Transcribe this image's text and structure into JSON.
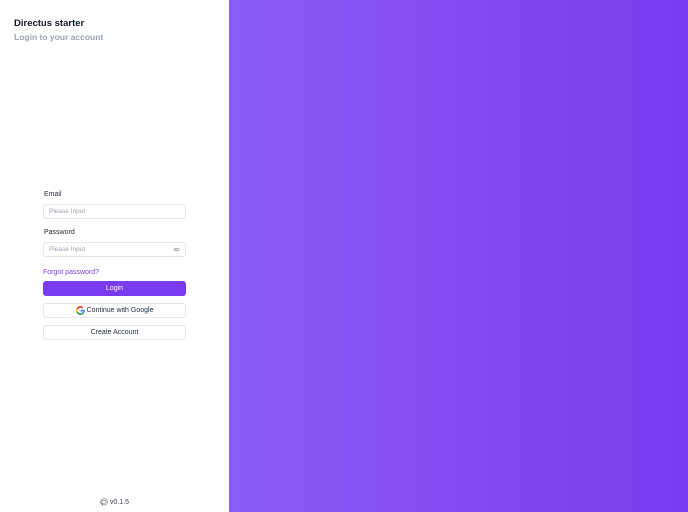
{
  "brand": {
    "title": "Directus starter",
    "subtitle": "Login to your account"
  },
  "form": {
    "email_label": "Email",
    "email_placeholder": "Please Input",
    "password_label": "Password",
    "password_placeholder": "Please Input",
    "forgot_label": "Forgot password?",
    "login_label": "Login",
    "google_label": "Continue with Google",
    "create_label": "Create Account"
  },
  "footer": {
    "version": "v0.1.5",
    "icon": "github-icon"
  },
  "colors": {
    "accent": "#7c3aed",
    "gradient_start": "#8b5cf6",
    "gradient_end": "#7c3aed"
  }
}
